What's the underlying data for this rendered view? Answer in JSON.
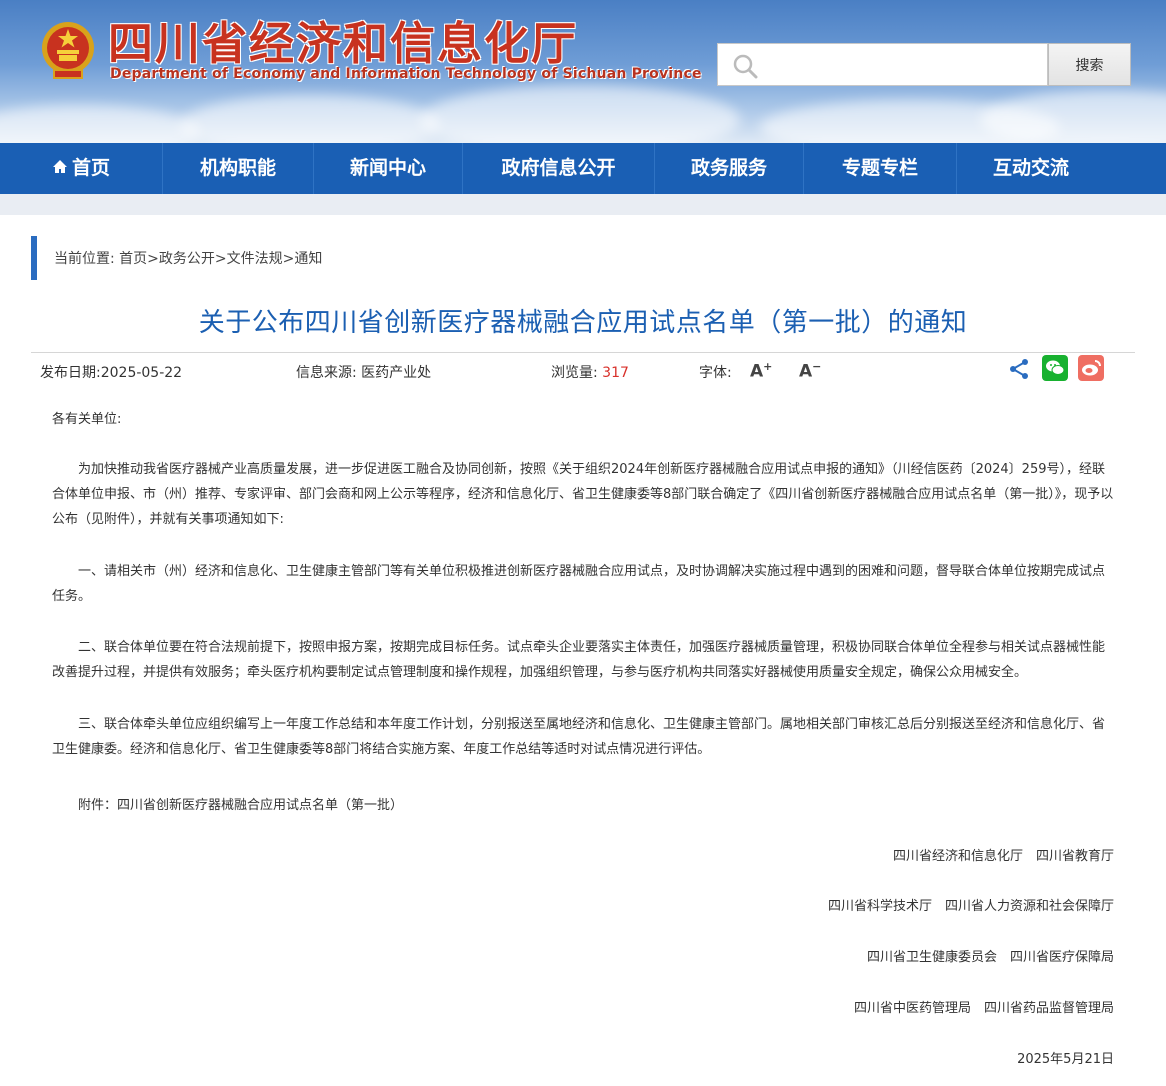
{
  "header": {
    "title": "四川省经济和信息化厅",
    "subtitle": "Department of Economy and Information Technology of Sichuan Province",
    "search_placeholder": "",
    "search_button": "搜索"
  },
  "nav": {
    "items": [
      {
        "label": "首页"
      },
      {
        "label": "机构职能"
      },
      {
        "label": "新闻中心"
      },
      {
        "label": "政府信息公开"
      },
      {
        "label": "政务服务"
      },
      {
        "label": "专题专栏"
      },
      {
        "label": "互动交流"
      }
    ]
  },
  "breadcrumb": {
    "prefix": "当前位置: ",
    "items": [
      "首页",
      "政务公开",
      "文件法规",
      "通知"
    ],
    "separator": ">"
  },
  "article": {
    "title": "关于公布四川省创新医疗器械融合应用试点名单（第一批）的通知",
    "publish_label": "发布日期:",
    "publish_date": "2025-05-22",
    "source_label": "信息来源: ",
    "source": "医药产业处",
    "views_label": "浏览量: ",
    "views": "317",
    "font_label": "字体:",
    "font_increase": "A",
    "font_decrease": "A",
    "greeting": "各有关单位:",
    "paragraphs": [
      "为加快推动我省医疗器械产业高质量发展，进一步促进医工融合及协同创新，按照《关于组织2024年创新医疗器械融合应用试点申报的通知》（川经信医药〔2024〕259号），经联合体单位申报、市（州）推荐、专家评审、部门会商和网上公示等程序，经济和信息化厅、省卫生健康委等8部门联合确定了《四川省创新医疗器械融合应用试点名单（第一批）》，现予以公布（见附件），并就有关事项通知如下:",
      "一、请相关市（州）经济和信息化、卫生健康主管部门等有关单位积极推进创新医疗器械融合应用试点，及时协调解决实施过程中遇到的困难和问题，督导联合体单位按期完成试点任务。",
      "二、联合体单位要在符合法规前提下，按照申报方案，按期完成目标任务。试点牵头企业要落实主体责任，加强医疗器械质量管理，积极协同联合体单位全程参与相关试点器械性能改善提升过程，并提供有效服务；牵头医疗机构要制定试点管理制度和操作规程，加强组织管理，与参与医疗机构共同落实好器械使用质量安全规定，确保公众用械安全。",
      "三、联合体牵头单位应组织编写上一年度工作总结和本年度工作计划，分别报送至属地经济和信息化、卫生健康主管部门。属地相关部门审核汇总后分别报送至经济和信息化厅、省卫生健康委。经济和信息化厅、省卫生健康委等8部门将结合实施方案、年度工作总结等适时对试点情况进行评估。"
    ],
    "attachment": "附件：四川省创新医疗器械融合应用试点名单（第一批）",
    "signatures": [
      "四川省经济和信息化厅　四川省教育厅",
      "四川省科学技术厅　四川省人力资源和社会保障厅",
      "四川省卫生健康委员会　四川省医疗保障局",
      "四川省中医药管理局　四川省药品监督管理局"
    ],
    "sign_date": "2025年5月21日"
  },
  "colors": {
    "nav_bg": "#1a5fb4",
    "title_blue": "#1b5fb2",
    "views_red": "#d8302a",
    "wechat_green": "#18b130",
    "weibo_red": "#ef6e62"
  }
}
